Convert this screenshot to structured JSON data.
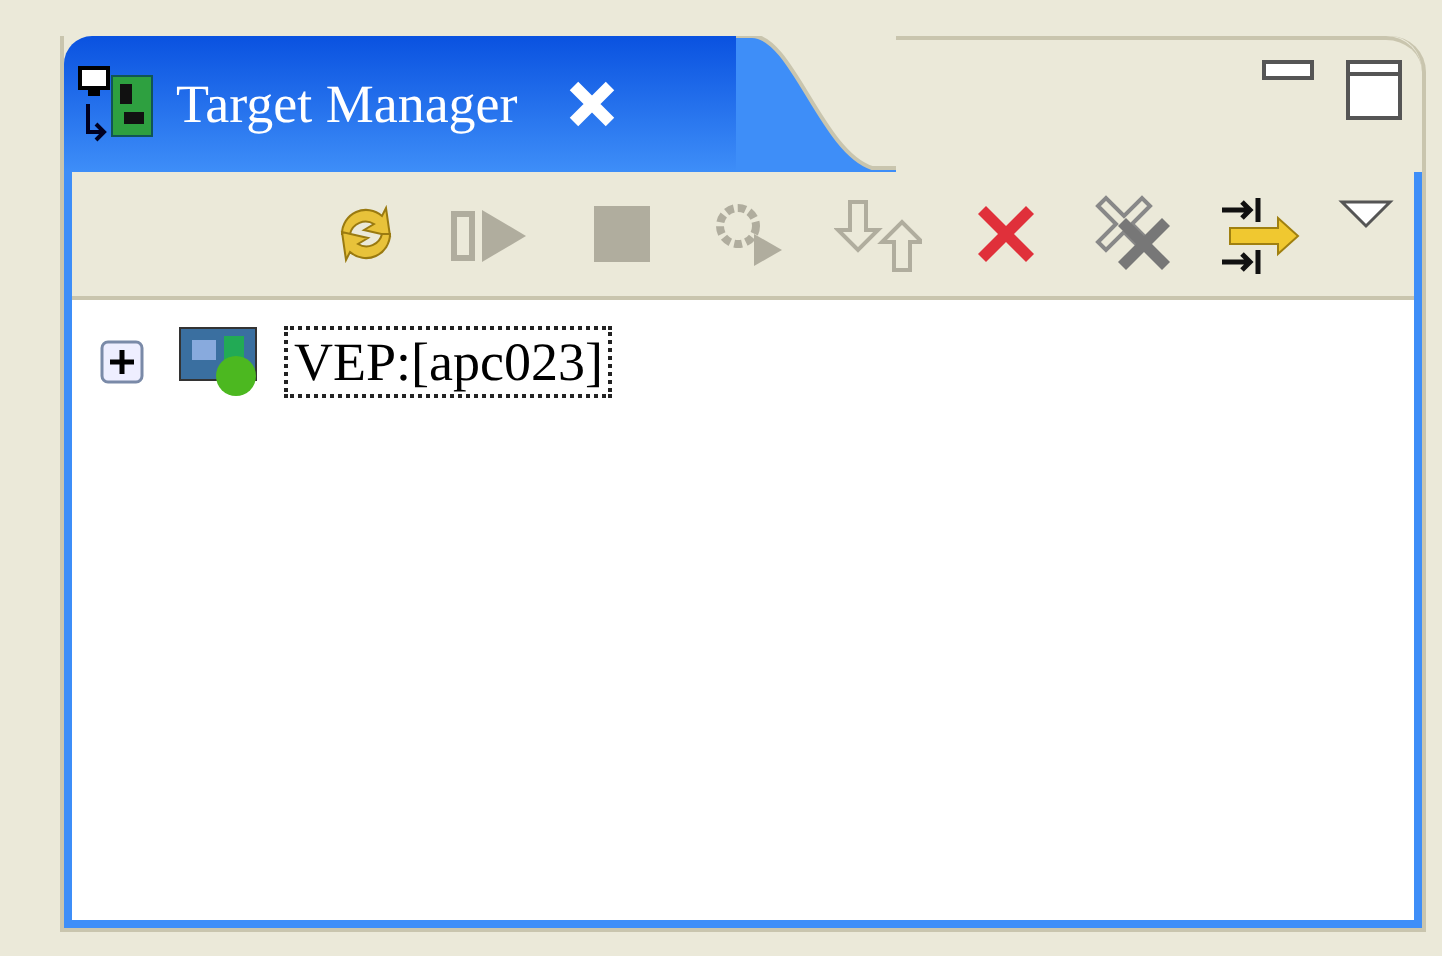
{
  "view": {
    "title": "Target Manager"
  },
  "toolbar": [
    {
      "kind": "refresh",
      "disabled": false
    },
    {
      "kind": "resume",
      "disabled": true
    },
    {
      "kind": "stop",
      "disabled": true
    },
    {
      "kind": "connect",
      "disabled": true
    },
    {
      "kind": "transfer",
      "disabled": true
    },
    {
      "kind": "delete",
      "disabled": false
    },
    {
      "kind": "delete-all",
      "disabled": false
    },
    {
      "kind": "merge",
      "disabled": false
    }
  ],
  "tree": [
    {
      "label": "VEP:[apc023]",
      "expanded": false,
      "selected": true
    }
  ]
}
